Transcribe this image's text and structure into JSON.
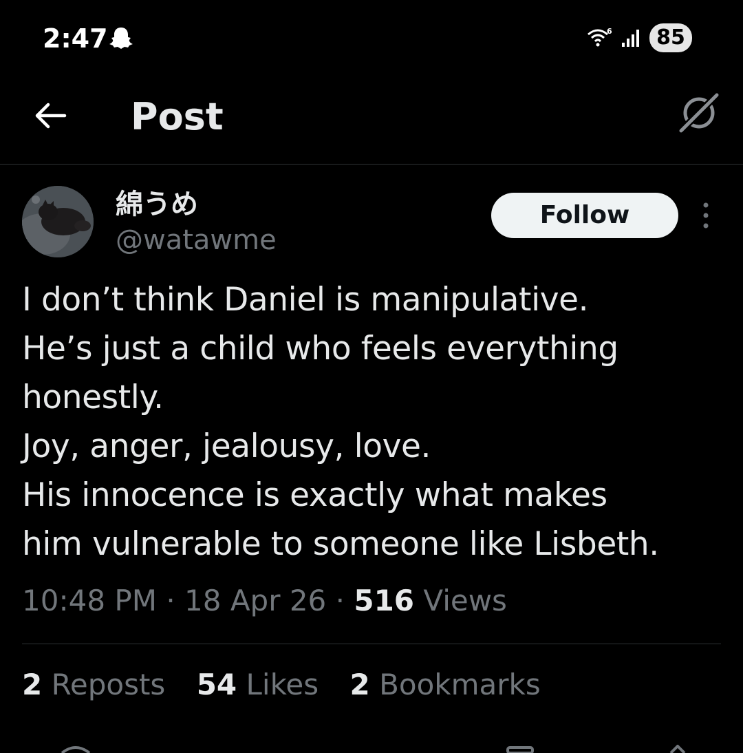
{
  "status_bar": {
    "time": "2:47",
    "battery": "85",
    "icons": [
      "snapchat-icon",
      "wifi-icon",
      "signal-icon"
    ]
  },
  "header": {
    "title": "Post",
    "icons": [
      "back-arrow-icon",
      "grok-icon"
    ]
  },
  "author": {
    "display_name": "綿うめ",
    "handle": "@watawme"
  },
  "follow_label": "Follow",
  "post": {
    "lines": [
      "I don’t think Daniel is manipulative.",
      "He’s just a child who feels everything",
      "honestly.",
      "Joy, anger, jealousy, love.",
      "His innocence is exactly what makes",
      "him vulnerable to someone like Lisbeth."
    ]
  },
  "meta": {
    "time": "10:48 PM",
    "sep": "·",
    "date": "18 Apr 26",
    "views_count": "516",
    "views_label": "Views"
  },
  "stats": {
    "reposts_count": "2",
    "reposts_label": "Reposts",
    "likes_count": "54",
    "likes_label": "Likes",
    "bookmarks_count": "2",
    "bookmarks_label": "Bookmarks"
  },
  "colors": {
    "background": "#000000",
    "text_primary": "#e7e9ea",
    "text_secondary": "#71767b",
    "divider": "#2f3336",
    "follow_bg": "#eff3f4"
  }
}
